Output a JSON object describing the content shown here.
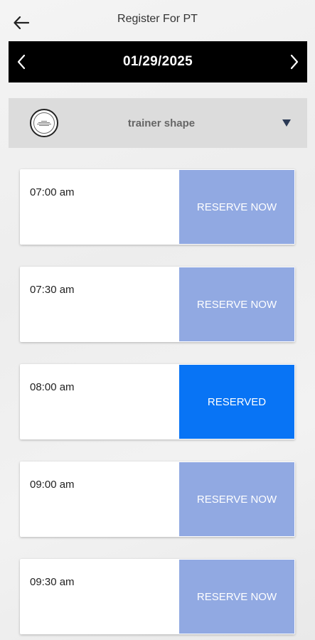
{
  "header": {
    "title": "Register For PT",
    "back_icon": "arrow-left-icon"
  },
  "date_nav": {
    "date": "01/29/2025",
    "prev_icon": "chevron-left-icon",
    "next_icon": "chevron-right-icon"
  },
  "trainer_select": {
    "selected": "trainer shape",
    "caret_icon": "caret-down-icon"
  },
  "colors": {
    "available": "#91a9e2",
    "reserved": "#0874f5",
    "date_bar": "#000000",
    "trainer_bar": "#dcdcdc"
  },
  "slots": [
    {
      "time": "07:00 am",
      "action": "RESERVE NOW",
      "status": "available"
    },
    {
      "time": "07:30 am",
      "action": "RESERVE NOW",
      "status": "available"
    },
    {
      "time": "08:00 am",
      "action": "RESERVED",
      "status": "reserved"
    },
    {
      "time": "09:00 am",
      "action": "RESERVE NOW",
      "status": "available"
    },
    {
      "time": "09:30 am",
      "action": "RESERVE NOW",
      "status": "available"
    }
  ]
}
